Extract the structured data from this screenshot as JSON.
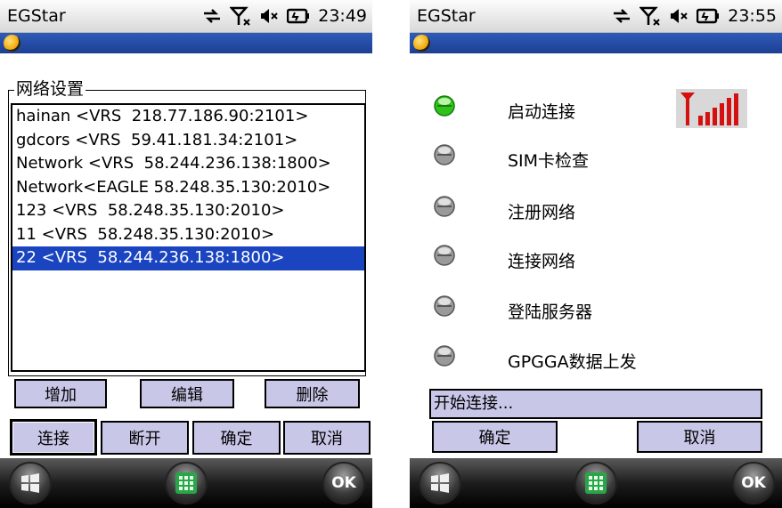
{
  "left_screen": {
    "window_title": "EGStar",
    "time": "23:49",
    "group_title": "网络设置",
    "network_list": [
      "hainan <VRS  218.77.186.90:2101>",
      "gdcors <VRS  59.41.181.34:2101>",
      "Network <VRS  58.244.236.138:1800>",
      "Network<EAGLE 58.248.35.130:2010>",
      "123 <VRS  58.248.35.130:2010>",
      "11 <VRS  58.248.35.130:2010>",
      "22 <VRS  58.244.236.138:1800>"
    ],
    "selected_index": 6,
    "buttons": {
      "add": "增加",
      "edit": "编辑",
      "delete": "删除",
      "connect": "连接",
      "disconnect": "断开",
      "ok": "确定",
      "cancel": "取消"
    }
  },
  "right_screen": {
    "window_title": "EGStar",
    "time": "23:55",
    "steps": [
      {
        "label": "启动连接",
        "state": "active"
      },
      {
        "label": "SIM卡检查",
        "state": "inactive"
      },
      {
        "label": "注册网络",
        "state": "inactive"
      },
      {
        "label": "连接网络",
        "state": "inactive"
      },
      {
        "label": "登陆服务器",
        "state": "inactive"
      },
      {
        "label": "GPGGA数据上发",
        "state": "inactive"
      }
    ],
    "status_message": "开始连接...",
    "buttons": {
      "ok": "确定",
      "cancel": "取消"
    }
  },
  "taskbar": {
    "ok_label": "OK"
  },
  "icons": {
    "sync": "sync-arrows-icon",
    "no_signal": "no-signal-icon",
    "speaker_muted": "speaker-muted-icon",
    "battery_charging": "battery-charging-icon",
    "signal_strength": "signal-strength-icon",
    "start_menu": "windows-start-icon",
    "keyboard": "keyboard-icon"
  },
  "colors": {
    "selection": "#1a44c0",
    "button_face": "#c9c7e8",
    "header_bar": "#1c3f94",
    "led_active": "#2ec21a",
    "led_inactive": "#8c8c8c",
    "signal_red": "#d41010"
  }
}
